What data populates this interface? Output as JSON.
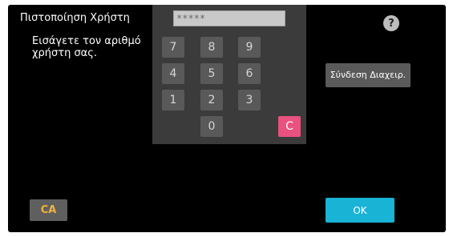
{
  "header": {
    "title": "Πιστοποίηση Χρήστη",
    "help_label": "?"
  },
  "prompt": {
    "text": "Εισάγετε τον αριθμό χρήστη σας."
  },
  "pin": {
    "value": "*****"
  },
  "keypad": {
    "keys": [
      "7",
      "8",
      "9",
      "4",
      "5",
      "6",
      "1",
      "2",
      "3",
      "0"
    ],
    "clear_label": "C"
  },
  "buttons": {
    "admin_login": "Σύνδεση Διαχειρ.",
    "clear_all": "CA",
    "ok": "OK"
  },
  "colors": {
    "background": "#000000",
    "keypad_panel": "#3b3b3b",
    "key": "#595959",
    "clear_key": "#e9517f",
    "ok_button": "#19b3d6",
    "ca_text": "#f2b23c"
  }
}
